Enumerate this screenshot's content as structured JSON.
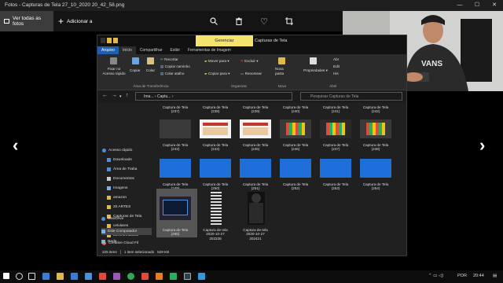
{
  "photos": {
    "window_title": "Fotos - Capturas de Tela 27_10_2020 20_42_58.png",
    "view_all_label": "Ver todas as fotos",
    "add_label": "Adicionar a"
  },
  "explorer": {
    "manage_tab": "Gerenciar",
    "window_title": "Capturas de Tela",
    "tabs": [
      "Arquivo",
      "Início",
      "Compartilhar",
      "Exibir",
      "Ferramentas de Imagem"
    ],
    "ribbon": {
      "pin_quick_access": "Fixar no\nAcesso rápido",
      "copy": "Copiar",
      "paste": "Colar",
      "cut": "Recortar",
      "copy_path": "Copiar caminho",
      "paste_shortcut": "Colar atalho",
      "move_to": "Mover para",
      "copy_to": "Copiar para",
      "delete": "Excluir",
      "rename": "Renomear",
      "new_folder": "Nova\npasta",
      "properties": "Propriedades",
      "open": "Abr",
      "edit": "Edit",
      "history": "His",
      "group_clipboard": "Área de Transferência",
      "group_organize": "Organizar",
      "group_new": "Novo",
      "group_open": "Abrir"
    },
    "address": {
      "path_1": "Ima...",
      "path_2": "Captu...",
      "search_placeholder": "Pesquisar Capturas de Tela"
    },
    "sidebar": [
      {
        "label": "Acesso rápido",
        "pinned": false
      },
      {
        "label": "Downloads",
        "pinned": true
      },
      {
        "label": "Área de Traba",
        "pinned": true
      },
      {
        "label": "Documentos",
        "pinned": true
      },
      {
        "label": "Imagens",
        "pinned": true
      },
      {
        "label": "amazon",
        "pinned": false
      },
      {
        "label": "20 ARTES",
        "pinned": false
      },
      {
        "label": "Capturas de Tela",
        "pinned": false
      },
      {
        "label": "celulares",
        "pinned": false
      },
      {
        "label": "tkt informaticas",
        "pinned": false
      },
      {
        "label": "Creative Cloud Fil",
        "pinned": false
      },
      {
        "label": "OneDrive",
        "pinned": false
      },
      {
        "label": "Este Computador",
        "pinned": false
      },
      {
        "label": "Rede",
        "pinned": false
      }
    ],
    "files_top_row": [
      "Captura de Tela\n(237)",
      "Captura de Tela\n(238)",
      "Captura de Tela\n(239)",
      "Captura de Tela\n(240)",
      "Captura de Tela\n(241)",
      "Captura de Tela\n(242)"
    ],
    "files_row2": [
      "Captura de Tela\n(243)",
      "Captura de Tela\n(244)",
      "Captura de Tela\n(245)",
      "Captura de Tela\n(246)",
      "Captura de Tela\n(247)",
      "Captura de Tela\n(248)"
    ],
    "files_row3": [
      "Captura de Tela\n(249)",
      "Captura de Tela\n(250)",
      "Captura de Tela\n(251)",
      "Captura de Tela\n(252)",
      "Captura de Tela\n(253)",
      "Captura de Tela\n(254)"
    ],
    "files_row4": [
      "Captura de Tela\n(255)",
      "Captura de tela\n2020-10-27\n202238",
      "Captura de tela\n2020-10-27\n202421"
    ],
    "status": {
      "items": "225 itens",
      "selected": "1 item selecionado",
      "size": "529 KB"
    }
  },
  "taskbar": {
    "language": "POR",
    "time": "20:44"
  }
}
